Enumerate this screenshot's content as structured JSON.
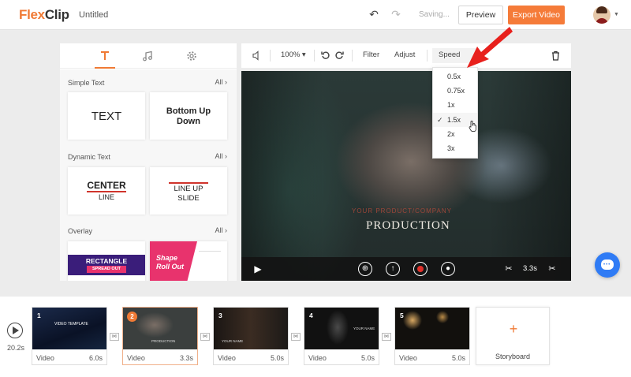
{
  "header": {
    "logo_flex": "Flex",
    "logo_clip": "Clip",
    "doc_title": "Untitled",
    "saving": "Saving...",
    "preview": "Preview",
    "export": "Export Video"
  },
  "left_panel": {
    "sections": [
      {
        "title": "Simple Text",
        "all": "All ›"
      },
      {
        "title": "Dynamic Text",
        "all": "All ›"
      },
      {
        "title": "Overlay",
        "all": "All ›"
      }
    ],
    "cards": {
      "text": "TEXT",
      "bottom_up_1": "Bottom Up",
      "bottom_up_2": "Down",
      "center": "CENTER",
      "line": "LINE",
      "line_up": "LINE UP",
      "slide": "SLIDE",
      "rectangle": "RECTANGLE",
      "spread_out": "SPREAD OUT",
      "shape": "Shape",
      "roll_out": "Roll Out"
    }
  },
  "toolbar": {
    "zoom": "100% ▾",
    "filter": "Filter",
    "adjust": "Adjust",
    "speed": "Speed"
  },
  "speed_menu": {
    "options": [
      "0.5x",
      "0.75x",
      "1x",
      "1.5x",
      "2x",
      "3x"
    ],
    "selected": "1.5x"
  },
  "video": {
    "subtitle": "YOUR PRODUCT/COMPANY",
    "title": "PRODUCTION",
    "duration": "3.3s"
  },
  "timeline": {
    "total_duration": "20.2s",
    "clips": [
      {
        "num": "1",
        "label": "Video",
        "duration": "6.0s",
        "caption": "VIDEO TEMPLATE"
      },
      {
        "num": "2",
        "label": "Video",
        "duration": "3.3s",
        "caption": "PRODUCTION"
      },
      {
        "num": "3",
        "label": "Video",
        "duration": "5.0s",
        "caption": "YOUR NAME"
      },
      {
        "num": "4",
        "label": "Video",
        "duration": "5.0s",
        "caption": "YOUR NAME"
      },
      {
        "num": "5",
        "label": "Video",
        "duration": "5.0s",
        "caption": ""
      }
    ],
    "storyboard": "Storyboard"
  },
  "colors": {
    "accent": "#f57b39",
    "chat": "#2f7bf5",
    "overlay_rect": "#3a1d7a",
    "overlay_shape": "#e8336d"
  }
}
